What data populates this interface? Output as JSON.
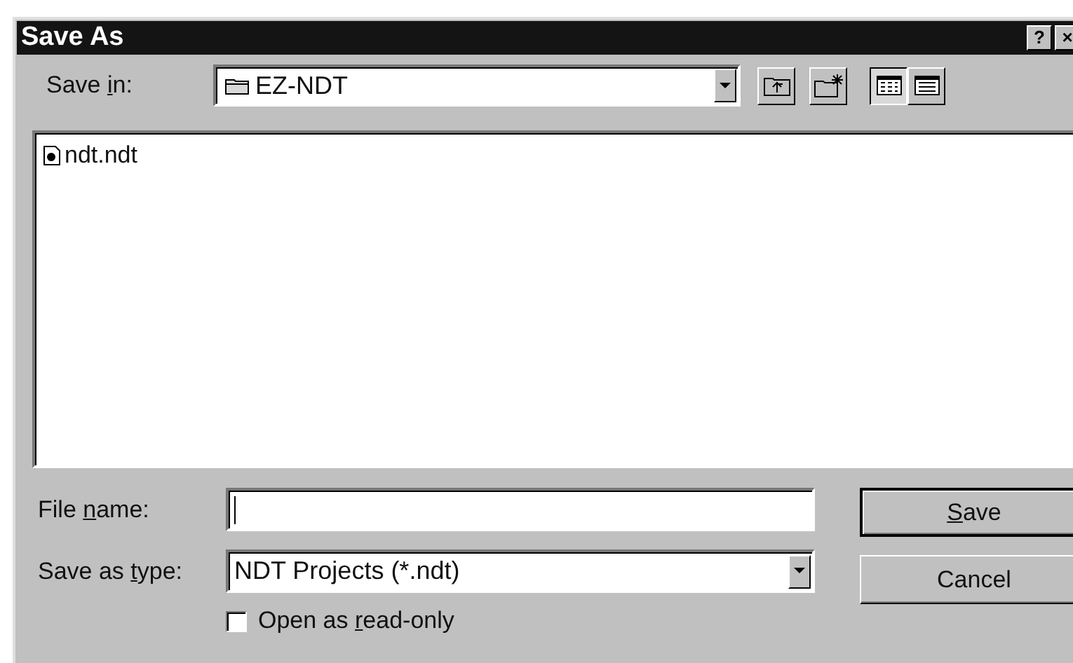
{
  "window": {
    "title": "Save As",
    "help_button": "?",
    "close_button": "×"
  },
  "save_in": {
    "label": [
      {
        "text": "Save ",
        "underline": false
      },
      {
        "text": "i",
        "underline": true
      },
      {
        "text": "n:",
        "underline": false
      }
    ],
    "value": "EZ-NDT"
  },
  "toolbar": [
    {
      "kind": "up"
    },
    {
      "kind": "new-folder"
    },
    {
      "kind": "list",
      "selected": true
    },
    {
      "kind": "details",
      "selected": false
    }
  ],
  "files": [
    {
      "name": "ndt.ndt",
      "selected": false
    }
  ],
  "file_name": {
    "label": [
      {
        "text": "File ",
        "underline": false
      },
      {
        "text": "n",
        "underline": true
      },
      {
        "text": "ame:",
        "underline": false
      }
    ]
  },
  "save_as_type": {
    "label": [
      {
        "text": "Save as ",
        "underline": false
      },
      {
        "text": "t",
        "underline": true
      },
      {
        "text": "ype:",
        "underline": false
      }
    ],
    "value": "NDT Projects (*.ndt)"
  },
  "read_only": {
    "label": [
      {
        "text": "Open as ",
        "underline": false
      },
      {
        "text": "r",
        "underline": true
      },
      {
        "text": "ead-only",
        "underline": false
      }
    ],
    "checked": false
  },
  "buttons": [
    {
      "label": [
        {
          "text": "S",
          "underline": true
        },
        {
          "text": "ave",
          "underline": false
        }
      ],
      "default": true
    },
    {
      "label": [
        {
          "text": "Cancel",
          "underline": false
        }
      ],
      "default": false
    }
  ]
}
